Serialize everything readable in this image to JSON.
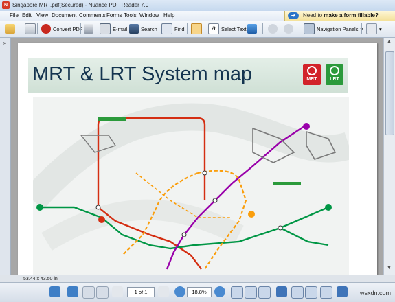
{
  "window": {
    "title": "Singapore MRT.pdf(Secured) - Nuance PDF Reader 7.0"
  },
  "menu": {
    "items": [
      "File",
      "Edit",
      "View",
      "Document",
      "Comments",
      "Forms",
      "Tools",
      "Window",
      "Help"
    ]
  },
  "promo": {
    "lead": "Need to",
    "strong": "make a form fillable?"
  },
  "toolbar": {
    "convert_pdf": "Convert PDF",
    "email": "E-mail",
    "search": "Search",
    "find": "Find",
    "select_text": "Select Text",
    "navigation_panels": "Navigation Panels"
  },
  "document": {
    "map_title": "MRT & LRT System map",
    "badge_mrt": "MRT",
    "badge_lrt": "LRT"
  },
  "status": {
    "dimensions": "53.44 x 43.50 in"
  },
  "nav": {
    "page_value": "1 of 1",
    "zoom_value": "18.8%"
  },
  "colors": {
    "mrt": "#d2232a",
    "lrt": "#2b9a3b",
    "north_south": "#d42e12",
    "east_west": "#009645",
    "north_east": "#9900aa",
    "circle": "#fa9e0d",
    "downtown": "#005ec4"
  },
  "watermark": "wsxdn.com"
}
